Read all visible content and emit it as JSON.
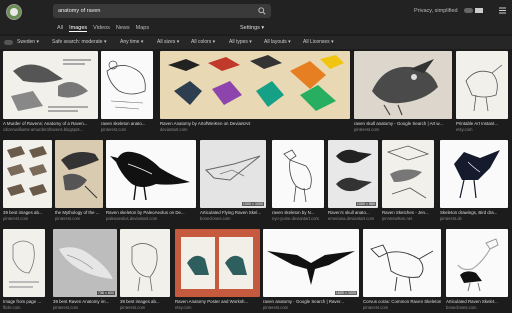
{
  "search": {
    "query": "anatomy of raven"
  },
  "nav": {
    "tabs": [
      "All",
      "Images",
      "Videos",
      "News",
      "Maps"
    ],
    "active": "Images",
    "settings": "Settings ▾"
  },
  "header": {
    "privacy": "Privacy, simplified"
  },
  "filters": [
    "Sweden ▾",
    "Safe search: moderate ▾",
    "Any time ▾",
    "All sizes ▾",
    "All colors ▾",
    "All types ▾",
    "All layouts ▾",
    "All Licenses ▾"
  ],
  "colors": {
    "accent": "#6b8f52",
    "background": "#1c1c1c",
    "header": "#222222"
  },
  "results": [
    {
      "caption": "A Murder of Ravens: Anatomy of a Raven...",
      "source": "citizenwilliams-amurderofravens.blogspot..."
    },
    {
      "caption": "raven skeleton anato...",
      "source": "pinterest.com"
    },
    {
      "caption": "Raven Anatomy by ArtofWeiKen on DeviantArt",
      "source": "deviantart.com"
    },
    {
      "caption": "raven skull anatomy - Google Search | Art w...",
      "source": "pinterest.com"
    },
    {
      "caption": "Printable Art Instant...",
      "source": "etsy.com"
    },
    {
      "caption": "39 best images ab...",
      "source": "pinterest.com"
    },
    {
      "caption": "the Mythology of the ...",
      "source": "pinterest.com"
    },
    {
      "caption": "Raven skeleton by PaleoAeolus on De...",
      "source": "paleoaeolus.deviantart.com"
    },
    {
      "caption": "Articulated Flying Raven Skel...",
      "source": "boneclones.com",
      "dim": "1000 × 1000"
    },
    {
      "caption": "raven skeleton by N...",
      "source": "nyo-yume.deviantart.com"
    },
    {
      "caption": "Raven's skull anato...",
      "source": "emeriana.deviantart.com",
      "dim": "1000 × 969"
    },
    {
      "caption": "Raven Sketches - Jen...",
      "source": "jennnewlson.net"
    },
    {
      "caption": "Skeleton drawings, Bird dra...",
      "source": "pinterest.de"
    },
    {
      "caption": "Image from page ...",
      "source": "flickr.com"
    },
    {
      "caption": "39 best Raven Anatomy im...",
      "source": "pinterest.com",
      "dim": "736 × 600"
    },
    {
      "caption": "39 best images ab...",
      "source": "pinterest.com"
    },
    {
      "caption": "Raven Anatomy Poster and Worksh...",
      "source": "etsy.com"
    },
    {
      "caption": "raven anatomy - Google Search | Raver...",
      "source": "pinterest.com",
      "dim": "1600 × 1000"
    },
    {
      "caption": "Corvus corax: Common Raven Skeleton...",
      "source": "pinterest.com"
    },
    {
      "caption": "Articulated Raven Skelet...",
      "source": "boneclones.com"
    }
  ]
}
